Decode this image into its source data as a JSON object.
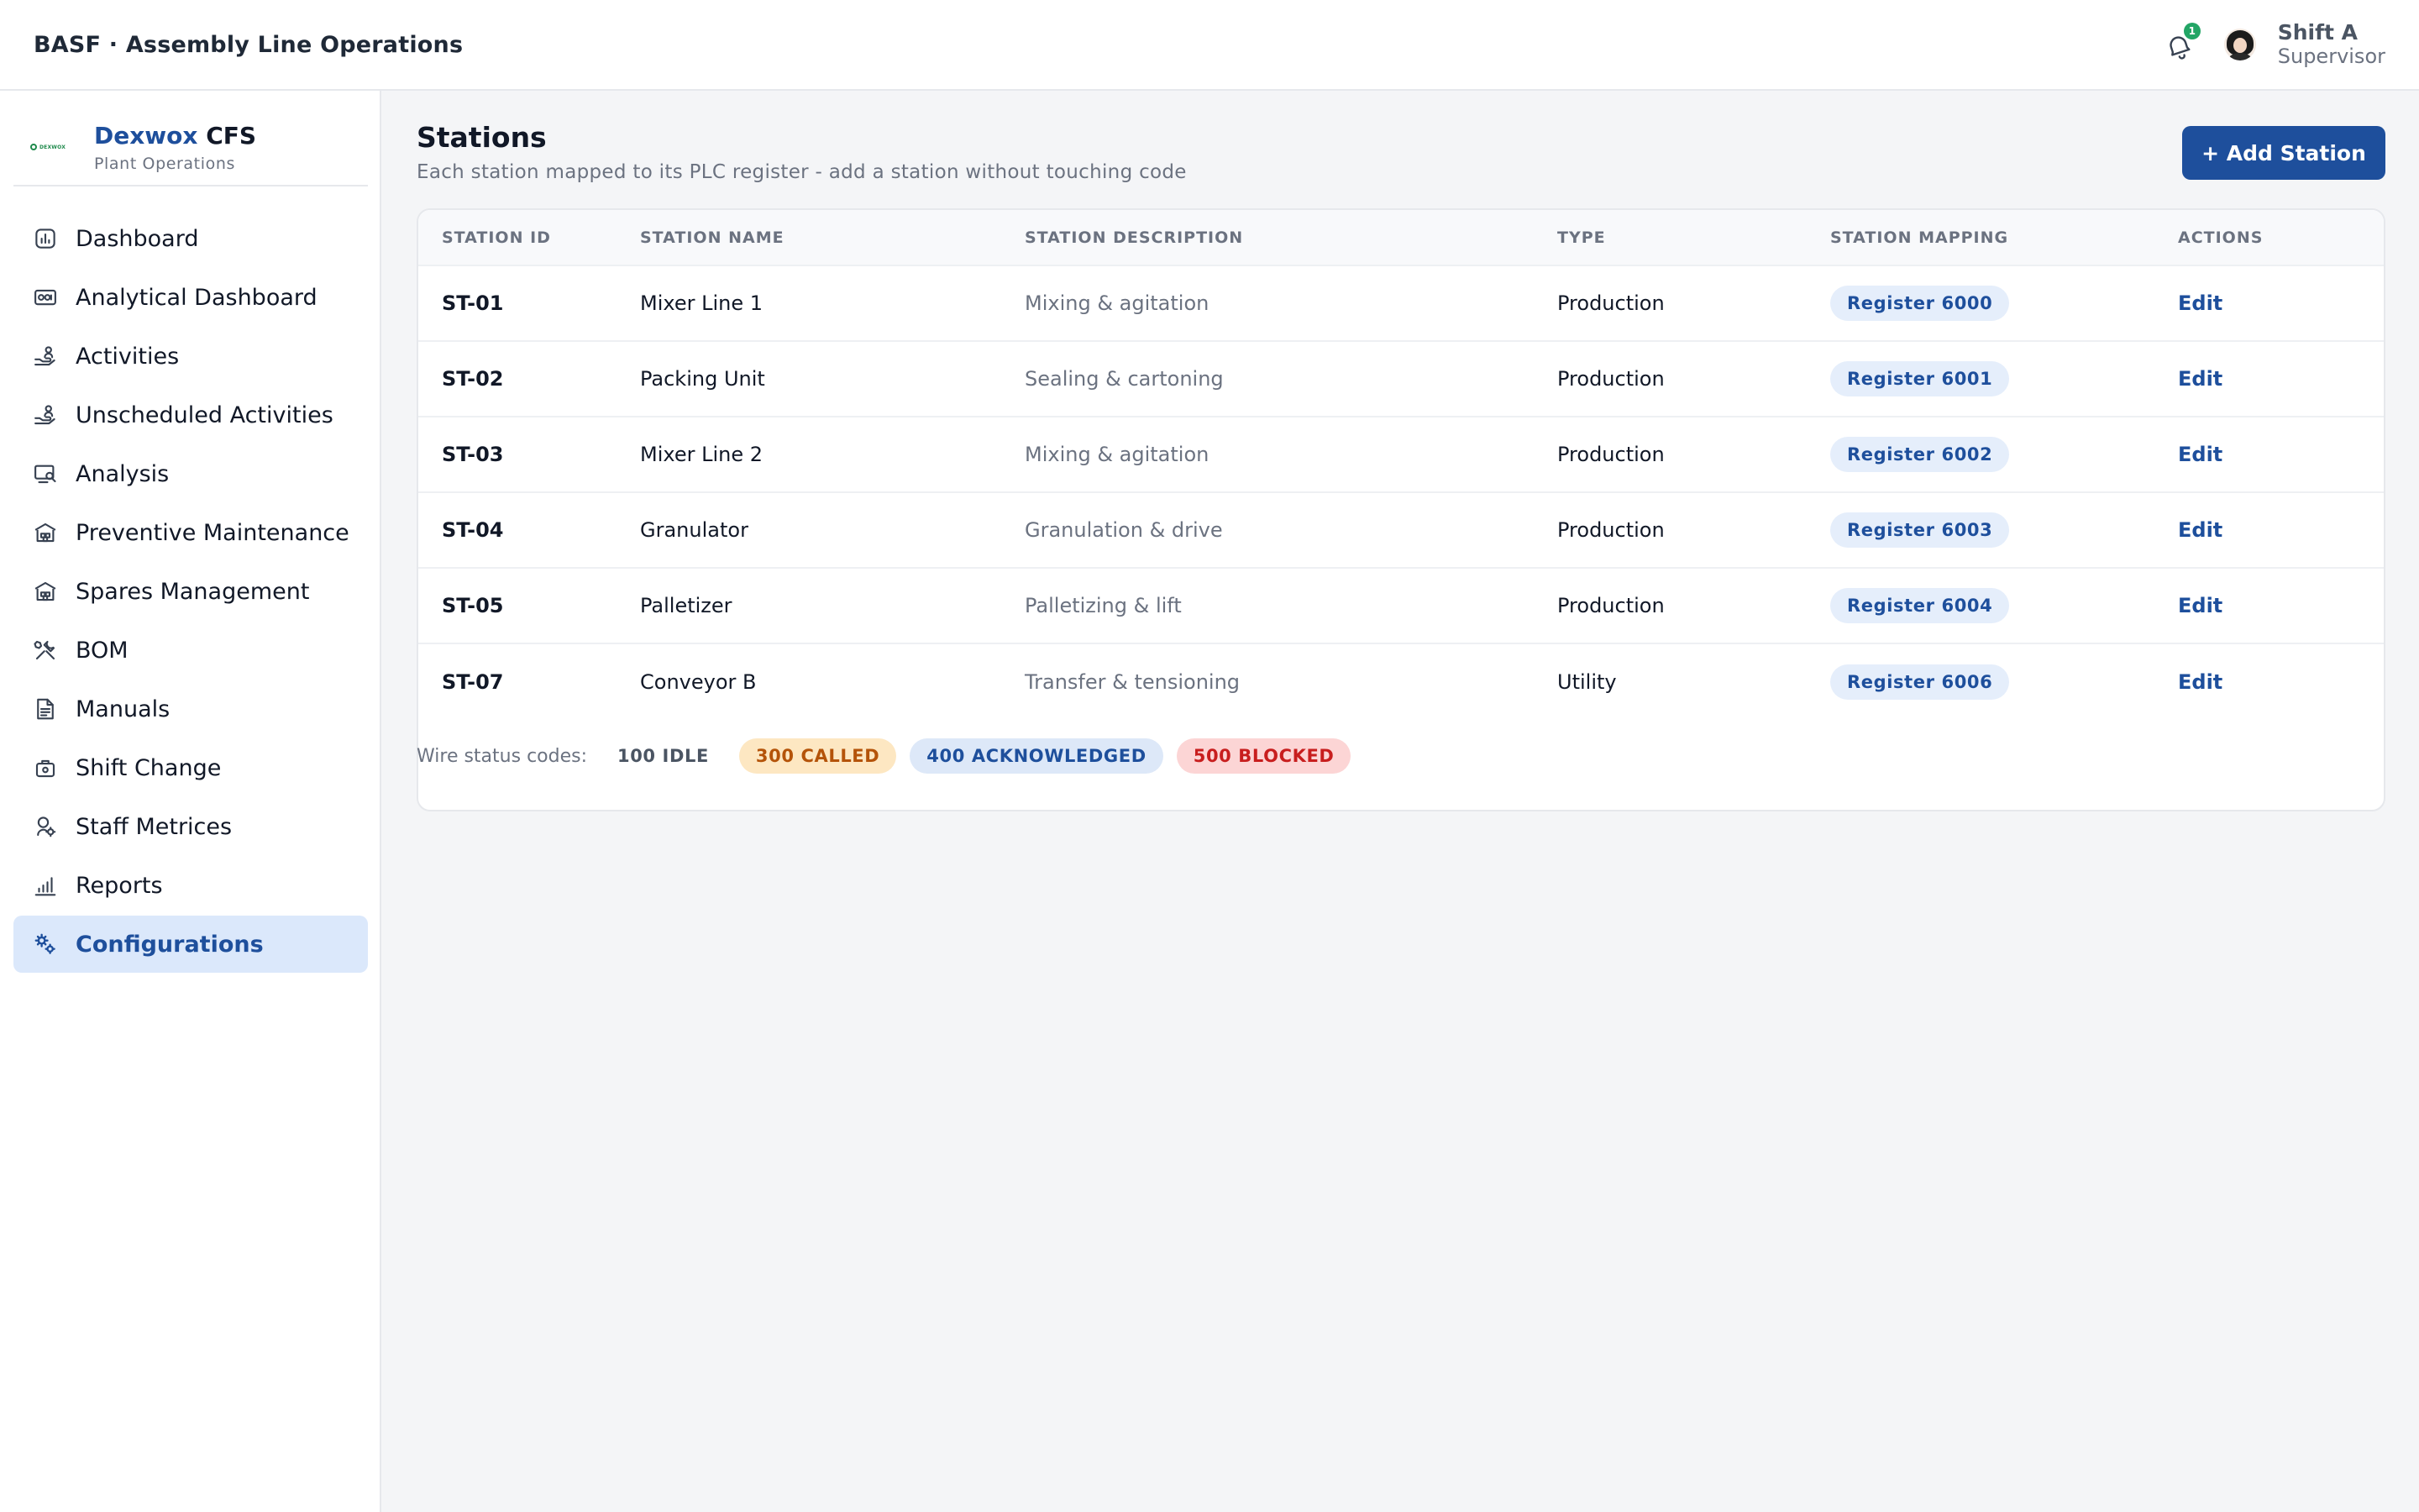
{
  "header": {
    "title": "BASF · Assembly Line Operations",
    "notification_count": "1",
    "user_name": "Shift A",
    "user_role": "Supervisor"
  },
  "brand": {
    "name_part1": "Dexwox",
    "name_part2": "CFS",
    "subtitle": "Plant Operations"
  },
  "sidebar": {
    "items": [
      {
        "label": "Dashboard",
        "icon": "chart-icon"
      },
      {
        "label": "Analytical Dashboard",
        "icon": "analytics-icon"
      },
      {
        "label": "Activities",
        "icon": "hand-person-icon"
      },
      {
        "label": "Unscheduled Activities",
        "icon": "hand-person-icon"
      },
      {
        "label": "Analysis",
        "icon": "monitor-search-icon"
      },
      {
        "label": "Preventive Maintenance",
        "icon": "warehouse-icon"
      },
      {
        "label": "Spares Management",
        "icon": "warehouse-icon"
      },
      {
        "label": "BOM",
        "icon": "tools-icon"
      },
      {
        "label": "Manuals",
        "icon": "document-icon"
      },
      {
        "label": "Shift Change",
        "icon": "briefcase-icon"
      },
      {
        "label": "Staff Metrices",
        "icon": "user-gear-icon"
      },
      {
        "label": "Reports",
        "icon": "bar-chart-icon"
      },
      {
        "label": "Configurations",
        "icon": "gears-icon",
        "active": true
      }
    ]
  },
  "main": {
    "title": "Stations",
    "subtitle": "Each station mapped to its PLC register - add a station without touching code",
    "add_button": "+ Add Station",
    "columns": [
      "STATION ID",
      "STATION NAME",
      "STATION DESCRIPTION",
      "TYPE",
      "STATION MAPPING",
      "ACTIONS"
    ],
    "rows": [
      {
        "id": "ST-01",
        "name": "Mixer Line 1",
        "description": "Mixing & agitation",
        "type": "Production",
        "mapping": "Register 6000",
        "action": "Edit"
      },
      {
        "id": "ST-02",
        "name": "Packing Unit",
        "description": "Sealing & cartoning",
        "type": "Production",
        "mapping": "Register 6001",
        "action": "Edit"
      },
      {
        "id": "ST-03",
        "name": "Mixer Line 2",
        "description": "Mixing & agitation",
        "type": "Production",
        "mapping": "Register 6002",
        "action": "Edit"
      },
      {
        "id": "ST-04",
        "name": "Granulator",
        "description": "Granulation & drive",
        "type": "Production",
        "mapping": "Register 6003",
        "action": "Edit"
      },
      {
        "id": "ST-05",
        "name": "Palletizer",
        "description": "Palletizing & lift",
        "type": "Production",
        "mapping": "Register 6004",
        "action": "Edit"
      },
      {
        "id": "ST-07",
        "name": "Conveyor B",
        "description": "Transfer & tensioning",
        "type": "Utility",
        "mapping": "Register 6006",
        "action": "Edit"
      }
    ],
    "legend": {
      "label": "Wire status codes:",
      "codes": [
        "100 IDLE",
        "300 CALLED",
        "400 ACKNOWLEDGED",
        "500 BLOCKED"
      ]
    }
  },
  "colors": {
    "accent": "#1e4f9c",
    "active_nav_bg": "#dbe8fb",
    "called": "#b45309",
    "blocked": "#c81e1e",
    "badge_green": "#22a565"
  }
}
